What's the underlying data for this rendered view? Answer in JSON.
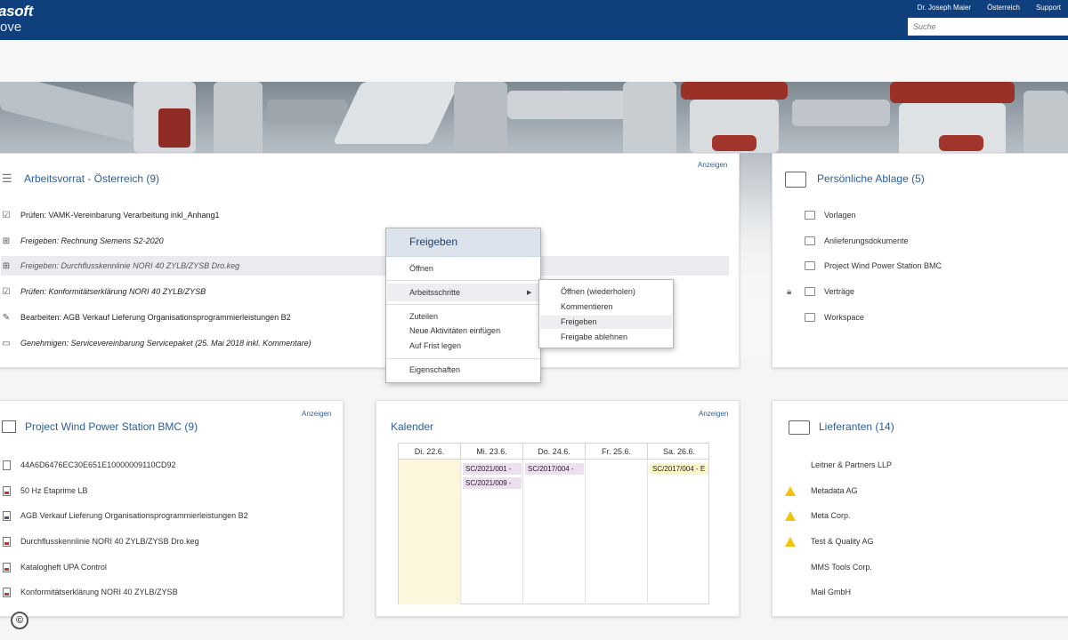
{
  "header": {
    "brand_top": "asoft",
    "brand_bottom": "ove",
    "user": "Dr. Joseph Maier",
    "region": "Österreich",
    "support": "Support",
    "search_placeholder": "Suche"
  },
  "worklist": {
    "title": "Arbeitsvorrat - Österreich (9)",
    "link": "Anzeigen",
    "items": [
      {
        "label": "Prüfen: VAMK-Vereinbarung Verarbeitung inkl_Anhang1",
        "icon": "check-doc-icon"
      },
      {
        "label": "Freigeben: Rechnung Siemens S2-2020",
        "icon": "approve-doc-icon"
      },
      {
        "label": "Freigeben: Durchflusskennlinie NORI 40 ZYLB/ZYSB Dro.keg",
        "icon": "approve-doc-icon"
      },
      {
        "label": "Prüfen: Konformitätserklärung NORI 40 ZYLB/ZYSB",
        "icon": "check-doc-icon"
      },
      {
        "label": "Bearbeiten: AGB Verkauf Lieferung Organisationsprogrammierleistungen B2",
        "icon": "pencil-icon"
      },
      {
        "label": "Genehmigen: Servicevereinbarung Servicepaket (25. Mai 2018 inkl. Kommentare)",
        "icon": "comment-icon"
      }
    ]
  },
  "context_menu": {
    "title": "Freigeben",
    "open": "Öffnen",
    "steps": "Arbeitsschritte",
    "assign": "Zuteilen",
    "add_activity": "Neue Aktivitäten einfügen",
    "set_deadline": "Auf Frist legen",
    "properties": "Eigenschaften",
    "submenu": [
      "Öffnen (wiederholen)",
      "Kommentieren",
      "Freigeben",
      "Freigabe ablehnen"
    ]
  },
  "storage": {
    "title": "Persönliche Ablage (5)",
    "items": [
      "Vorlagen",
      "Anlieferungsdokumente",
      "Project Wind Power Station BMC",
      "Verträge",
      "Workspace"
    ]
  },
  "project": {
    "title": "Project Wind Power Station BMC (9)",
    "link": "Anzeigen",
    "items": [
      {
        "label": "44A6D6476EC30E651E10000009110CD92",
        "icon": "text-doc-icon"
      },
      {
        "label": "50 Hz Etaprime LB",
        "icon": "pdf-icon"
      },
      {
        "label": "AGB Verkauf Lieferung Organisationsprogrammierleistungen B2",
        "icon": "word-doc-icon"
      },
      {
        "label": "Durchflusskennlinie NORI 40 ZYLB/ZYSB Dro.keg",
        "icon": "pdf-icon"
      },
      {
        "label": "Katalogheft UPA Control",
        "icon": "pdf-icon"
      },
      {
        "label": "Konformitätserklärung NORI 40 ZYLB/ZYSB",
        "icon": "pdf-icon"
      }
    ]
  },
  "calendar": {
    "title": "Kalender",
    "link": "Anzeigen",
    "days": [
      "Di. 22.6.",
      "Mi. 23.6.",
      "Do. 24.6.",
      "Fr. 25.6.",
      "Sa. 26.6."
    ],
    "events": [
      {
        "day": 1,
        "text": "SC/2021/001 - ",
        "color": "#ecdff0"
      },
      {
        "day": 1,
        "text": "SC/2021/009 - ",
        "color": "#ecdff0"
      },
      {
        "day": 2,
        "text": "SC/2017/004 - ",
        "color": "#ecdff0"
      },
      {
        "day": 4,
        "text": "SC/2017/004 - E",
        "color": "#fbf6c9"
      }
    ]
  },
  "suppliers": {
    "title": "Lieferanten (14)",
    "items": [
      {
        "label": "Leitner & Partners LLP",
        "warning": false
      },
      {
        "label": "Metadata AG",
        "warning": true
      },
      {
        "label": "Meta Corp.",
        "warning": true
      },
      {
        "label": "Test & Quality AG",
        "warning": true
      },
      {
        "label": "MMS Tools Corp.",
        "warning": false
      },
      {
        "label": "Mail GmbH",
        "warning": false
      }
    ]
  },
  "footer": {
    "copyright": "©"
  }
}
